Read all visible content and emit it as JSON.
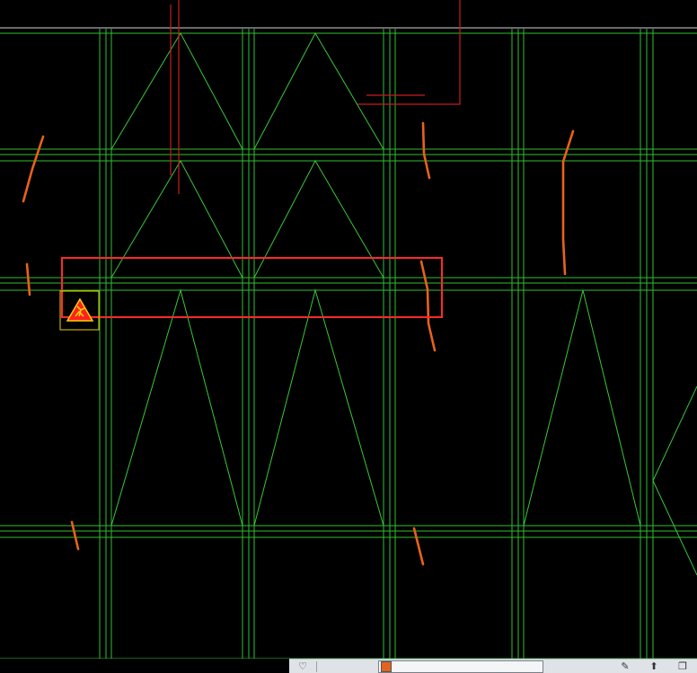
{
  "colors": {
    "background": "#000000",
    "grid_lines": "#2fbf2f",
    "door_swing_lines": "#39c739",
    "red_lines": "#c81e1e",
    "selection_rect": "#ff2a2a",
    "crack_marks": "#e8621a",
    "marker_fill": "#ff2020",
    "marker_symbol": "#ffd000",
    "marker_box": "#e8d000",
    "statusbar_bg": "#dfe3e8",
    "layer_swatch": "#e0641e"
  },
  "icons": {
    "warning_marker": "warning-triangle-icon",
    "status_left": "workspace-icon",
    "status_tools": [
      "pen-icon",
      "arrow-up-icon",
      "window-icon"
    ]
  },
  "statusbar": {
    "left_label": "",
    "layer_value": ""
  }
}
